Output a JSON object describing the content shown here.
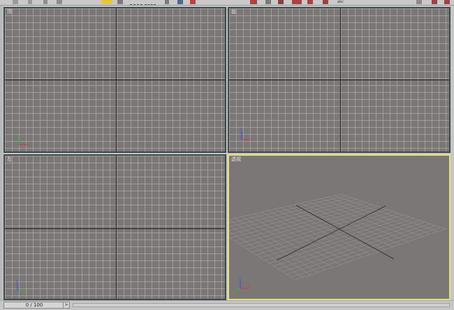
{
  "viewports": [
    {
      "id": "top",
      "label": "顶",
      "active": false
    },
    {
      "id": "front",
      "label": "前",
      "active": false
    },
    {
      "id": "left",
      "label": "左",
      "active": false
    },
    {
      "id": "perspective",
      "label": "透视",
      "active": true
    }
  ],
  "toolbar": {
    "icons": [
      "select-icon",
      "select-region-icon",
      "move-icon",
      "rotate-icon",
      "scale-icon",
      "snap-icon",
      "mirror-icon",
      "align-icon",
      "render-icon"
    ],
    "text_label": "abc"
  },
  "gizmo": {
    "x_label": "x",
    "y_label": "y",
    "z_label": "z"
  },
  "timeline": {
    "frame_readout": "0 / 100",
    "next_glyph": ">"
  },
  "colors": {
    "viewport_bg": "#7b7777",
    "active_border": "#e8e07a",
    "inactive_border": "#3c4a4c",
    "axis_x": "#d83a3a",
    "axis_y": "#3fb03f",
    "axis_z": "#3a52d8",
    "toolbar_highlight": "#e8c63a"
  }
}
